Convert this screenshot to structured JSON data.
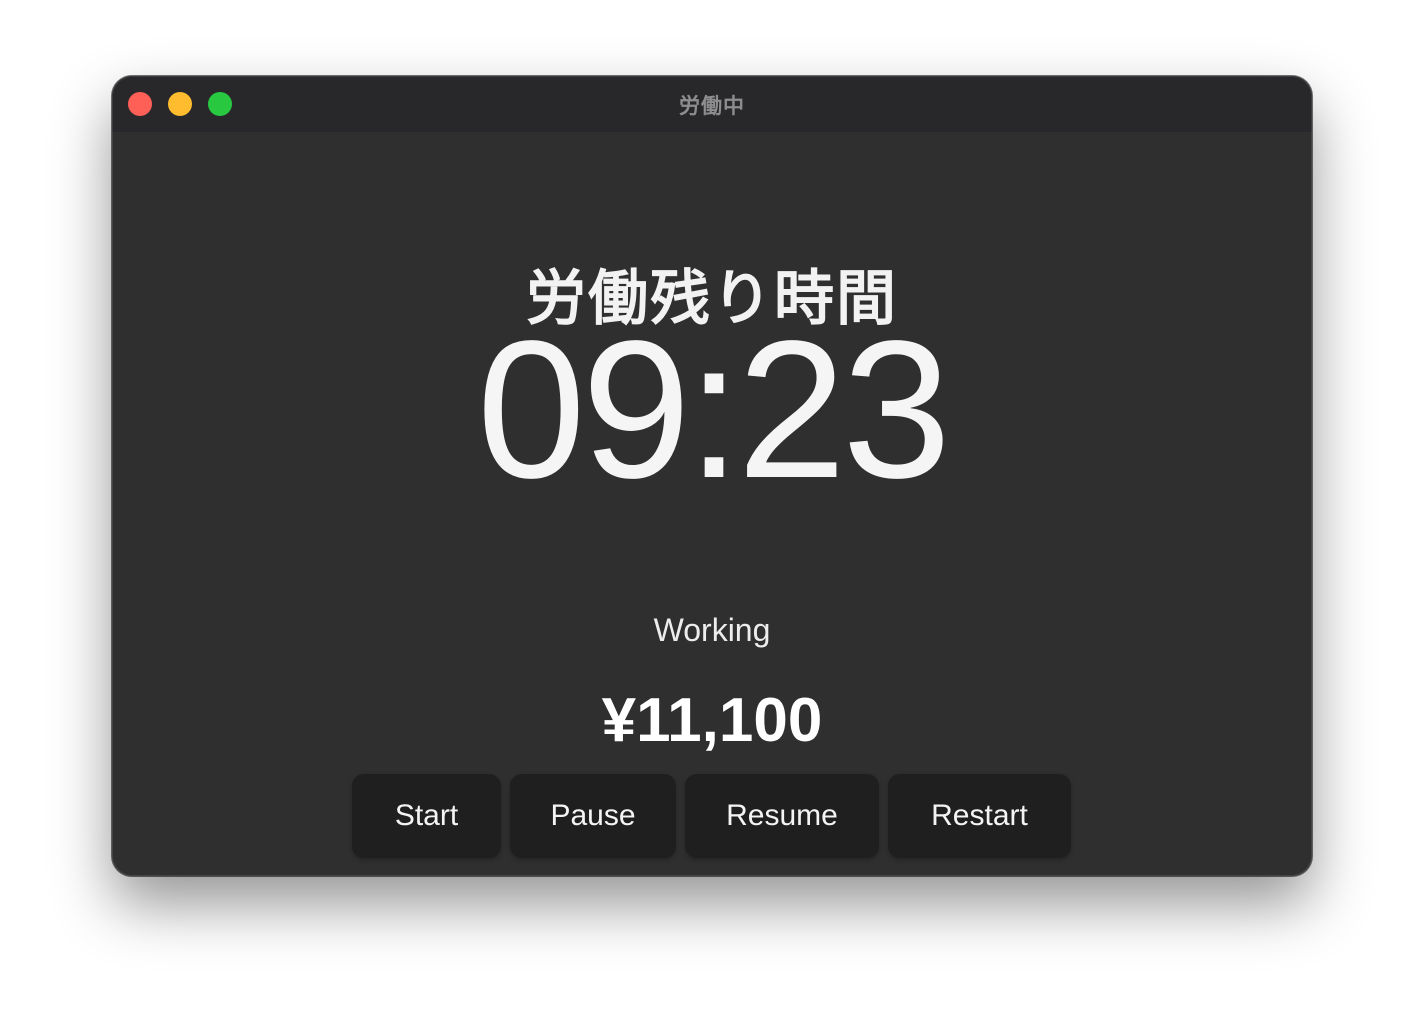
{
  "window": {
    "title": "労働中"
  },
  "main": {
    "heading": "労働残り時間",
    "timer": "09:23",
    "status": "Working",
    "earnings": "¥11,100"
  },
  "buttons": {
    "start": "Start",
    "pause": "Pause",
    "resume": "Resume",
    "restart": "Restart"
  },
  "colors": {
    "window_background": "#2f2f2f",
    "titlebar_background": "#28282b",
    "button_background": "#1f1f1f",
    "close": "#fe5f57",
    "minimize": "#febc2e",
    "zoom": "#28c840"
  }
}
